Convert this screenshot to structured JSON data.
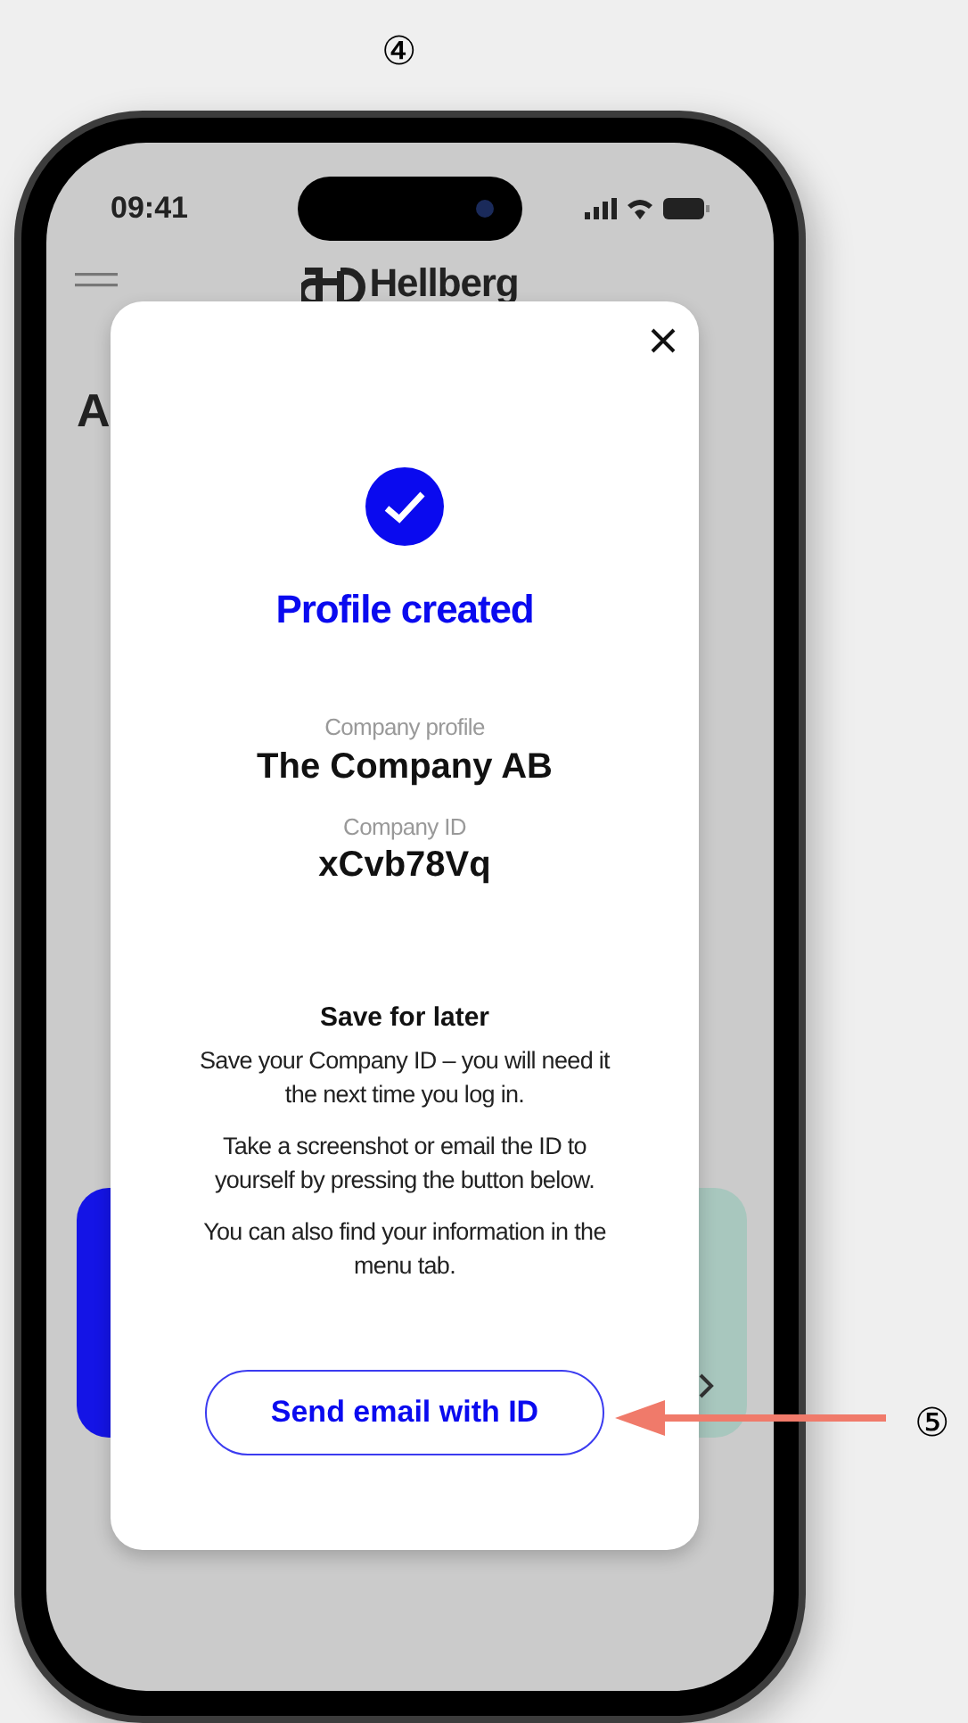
{
  "step_markers": [
    "④",
    "⑤"
  ],
  "status_bar": {
    "time": "09:41"
  },
  "header": {
    "brand": "Hellberg"
  },
  "background": {
    "heading_fragment": "A"
  },
  "modal": {
    "title": "Profile created",
    "fields": [
      {
        "label": "Company profile",
        "value": "The Company AB"
      },
      {
        "label": "Company ID",
        "value": "xCvb78Vq"
      }
    ],
    "note_heading": "Save for later",
    "paragraphs": [
      "Save your Company ID – you will need it the next time you log in.",
      "Take a screenshot  or email the ID to yourself by pressing the button below.",
      "You can also find your information in the menu tab."
    ],
    "button": "Send email with ID"
  }
}
